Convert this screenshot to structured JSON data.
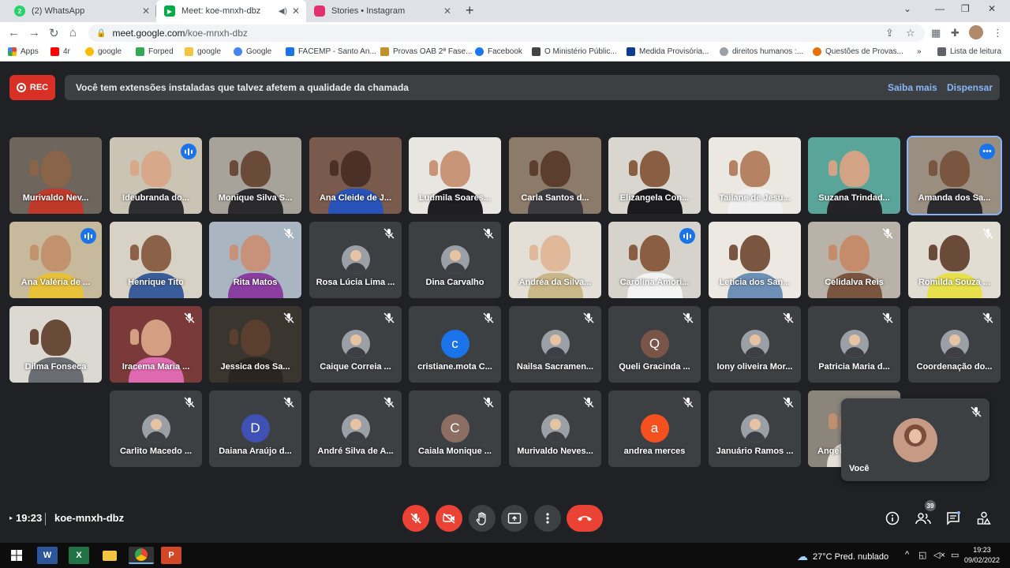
{
  "browser": {
    "tabs": [
      {
        "title": "(2) WhatsApp",
        "color": "#25d366"
      },
      {
        "title": "Meet: koe-mnxh-dbz",
        "color": "#00ac47"
      },
      {
        "title": "Stories • Instagram",
        "color": "#e1306c"
      }
    ],
    "url_host": "meet.google.com",
    "url_path": "/koe-mnxh-dbz",
    "bookmarks": [
      {
        "label": "Apps",
        "color": "#ea4335"
      },
      {
        "label": "4r",
        "color": "#ff0000"
      },
      {
        "label": "google",
        "color": "#fbbc04"
      },
      {
        "label": "Forped",
        "color": "#34a853"
      },
      {
        "label": "google",
        "color": "#f4c542"
      },
      {
        "label": "Google",
        "color": "#4285f4"
      },
      {
        "label": "FACEMP - Santo An...",
        "color": "#1a73e8"
      },
      {
        "label": "Provas OAB 2ª Fase...",
        "color": "#c28f2c"
      },
      {
        "label": "Facebook",
        "color": "#1877f2"
      },
      {
        "label": "O Ministério Públic...",
        "color": "#444444"
      },
      {
        "label": "Medida Provisória...",
        "color": "#0b3d91"
      },
      {
        "label": "direitos humanos :...",
        "color": "#9aa0a6"
      },
      {
        "label": "Questões de Provas...",
        "color": "#e8710a"
      },
      {
        "label": "Lista de leitura",
        "color": "#5f6368"
      }
    ]
  },
  "meet": {
    "rec_label": "REC",
    "banner_text": "Você tem extensões instaladas que talvez afetem a qualidade da chamada",
    "banner_learn": "Saiba mais",
    "banner_dismiss": "Dispensar",
    "participants": [
      {
        "name": "Murivaldo Nev...",
        "kind": "video",
        "bg": "#6e655c",
        "skin": "#8a6449",
        "shirt": "#c03a2b"
      },
      {
        "name": "Ideubranda do...",
        "kind": "video",
        "bg": "#cbc3b4",
        "skin": "#d7a98a",
        "shirt": "#2e2e33",
        "speaking": true
      },
      {
        "name": "Monique Silva S...",
        "kind": "video",
        "bg": "#a8a39a",
        "skin": "#6a4a39",
        "shirt": "#2b2b2e"
      },
      {
        "name": "Ana Cleide de J...",
        "kind": "video",
        "bg": "#7a5a4c",
        "skin": "#4a3026",
        "shirt": "#2853b8"
      },
      {
        "name": "Ludmila Soares...",
        "kind": "video",
        "bg": "#e8e6e1",
        "skin": "#c99578",
        "shirt": "#1e1e22"
      },
      {
        "name": "Carla Santos d...",
        "kind": "video",
        "bg": "#8d7b6a",
        "skin": "#5c3e2e",
        "shirt": "#3c3c40"
      },
      {
        "name": "Elizangela Con...",
        "kind": "video",
        "bg": "#d9d6cf",
        "skin": "#8a5e43",
        "shirt": "#1b1b1e"
      },
      {
        "name": "Tailane de Jesu...",
        "kind": "video",
        "bg": "#ebe8e2",
        "skin": "#b58363",
        "shirt": "#f0f0f0"
      },
      {
        "name": "Suzana Trindad...",
        "kind": "video",
        "bg": "#5aa59a",
        "skin": "#d2a385",
        "shirt": "#242428"
      },
      {
        "name": "Amanda dos Sa...",
        "kind": "video",
        "bg": "#9a8e80",
        "skin": "#7a5540",
        "shirt": "#2a2a2d",
        "selected": true,
        "more": true
      },
      {
        "name": "Ana Valéria de ...",
        "kind": "video",
        "bg": "#c7b99c",
        "skin": "#c2926f",
        "shirt": "#e8c13a",
        "speaking": true
      },
      {
        "name": "Henrique Tito",
        "kind": "video",
        "bg": "#d8d2c6",
        "skin": "#8b6248",
        "shirt": "#3b5c9a"
      },
      {
        "name": "Rita Matos",
        "kind": "video",
        "bg": "#a9b6c2",
        "skin": "#c8917a",
        "shirt": "#8a3fa0",
        "muted": true
      },
      {
        "name": "Rosa Lúcia Lima ...",
        "kind": "avatar",
        "avatar": "pic",
        "muted": true
      },
      {
        "name": "Dina Carvalho",
        "kind": "avatar",
        "avatar": "pic",
        "muted": true
      },
      {
        "name": "Andréa da Silva...",
        "kind": "video",
        "bg": "#e3ded6",
        "skin": "#e0b89a",
        "shirt": "#c9b78a"
      },
      {
        "name": "Carolina Amori...",
        "kind": "video",
        "bg": "#d6d3cc",
        "skin": "#8a5e43",
        "shirt": "#f3f3f3",
        "speaking": true
      },
      {
        "name": "Leticia dos San...",
        "kind": "video",
        "bg": "#ede9e2",
        "skin": "#7a5540",
        "shirt": "#6e8fb6"
      },
      {
        "name": "Celidalva Reis",
        "kind": "video",
        "bg": "#b9b2a8",
        "skin": "#c58c6c",
        "shirt": "#7a5540",
        "muted": true
      },
      {
        "name": "Romilda Souza ...",
        "kind": "video",
        "bg": "#e2ddd3",
        "skin": "#6a4a39",
        "shirt": "#e7e04a",
        "muted": true
      },
      {
        "name": "Dilma Fonseca",
        "kind": "video",
        "bg": "#dcd9d3",
        "skin": "#6a4a39",
        "shirt": "#6a6e73"
      },
      {
        "name": "Iracema Maria ...",
        "kind": "video",
        "bg": "#7a3a3a",
        "skin": "#d39e82",
        "shirt": "#e06ab0",
        "muted": true
      },
      {
        "name": "Jessica dos Sa...",
        "kind": "video",
        "bg": "#3a352f",
        "skin": "#5a3e2e",
        "shirt": "#2a2520",
        "muted": true
      },
      {
        "name": "Caique Correia ...",
        "kind": "avatar",
        "avatar": "pic",
        "muted": true
      },
      {
        "name": "cristiane.mota C...",
        "kind": "avatar",
        "letter": "c",
        "color": "#1a73e8",
        "muted": true
      },
      {
        "name": "Nailsa Sacramen...",
        "kind": "avatar",
        "avatar": "pic",
        "muted": true
      },
      {
        "name": "Queli Gracinda ...",
        "kind": "avatar",
        "letter": "Q",
        "color": "#795548",
        "muted": true
      },
      {
        "name": "Iony oliveira Mor...",
        "kind": "avatar",
        "avatar": "pic",
        "muted": true
      },
      {
        "name": "Patricia Maria d...",
        "kind": "avatar",
        "avatar": "pic",
        "muted": true
      },
      {
        "name": "Coordenação do...",
        "kind": "avatar",
        "avatar": "pic",
        "muted": true
      },
      {
        "name": "Carlito Macedo ...",
        "kind": "avatar",
        "avatar": "pic",
        "muted": true
      },
      {
        "name": "Daiana Araújo d...",
        "kind": "avatar",
        "letter": "D",
        "color": "#3f51b5",
        "muted": true
      },
      {
        "name": "André Silva de A...",
        "kind": "avatar",
        "avatar": "pic",
        "muted": true
      },
      {
        "name": "Caiala Monique ...",
        "kind": "avatar",
        "letter": "C",
        "color": "#8d6e63",
        "muted": true
      },
      {
        "name": "Murivaldo Neves...",
        "kind": "avatar",
        "avatar": "pic",
        "muted": true
      },
      {
        "name": "andrea merces",
        "kind": "avatar",
        "letter": "a",
        "color": "#f4511e",
        "muted": true
      },
      {
        "name": "Januário Ramos ...",
        "kind": "avatar",
        "avatar": "pic",
        "muted": true
      },
      {
        "name": "Angel",
        "kind": "video",
        "bg": "#8c857c",
        "skin": "#c08f6e",
        "shirt": "#e3e0da"
      }
    ],
    "self_label": "Você",
    "clock": "19:23",
    "meeting_code": "koe-mnxh-dbz",
    "participant_count": "39"
  },
  "taskbar": {
    "weather": "27°C  Pred. nublado",
    "time": "19:23",
    "date": "09/02/2022"
  }
}
